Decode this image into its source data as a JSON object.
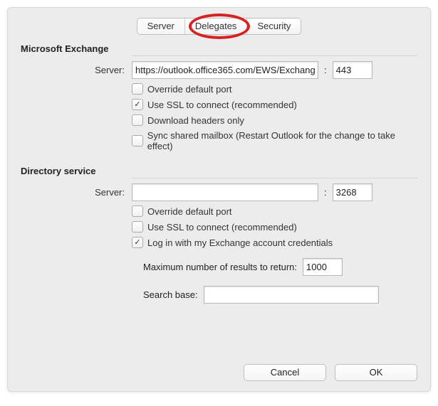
{
  "tabs": {
    "server": "Server",
    "delegates": "Delegates",
    "security": "Security"
  },
  "exchange": {
    "section_title": "Microsoft Exchange",
    "server_label": "Server:",
    "server_value": "https://outlook.office365.com/EWS/Exchang",
    "port_value": "443",
    "opt_override": "Override default port",
    "opt_ssl": "Use SSL to connect (recommended)",
    "opt_headers": "Download headers only",
    "opt_sync_shared": "Sync shared mailbox (Restart Outlook for the change to take effect)"
  },
  "directory": {
    "section_title": "Directory service",
    "server_label": "Server:",
    "server_value": "",
    "port_value": "3268",
    "opt_override": "Override default port",
    "opt_ssl": "Use SSL to connect (recommended)",
    "opt_login": "Log in with my Exchange account credentials",
    "max_results_label": "Maximum number of results to return:",
    "max_results_value": "1000",
    "search_base_label": "Search base:",
    "search_base_value": ""
  },
  "footer": {
    "cancel": "Cancel",
    "ok": "OK"
  }
}
